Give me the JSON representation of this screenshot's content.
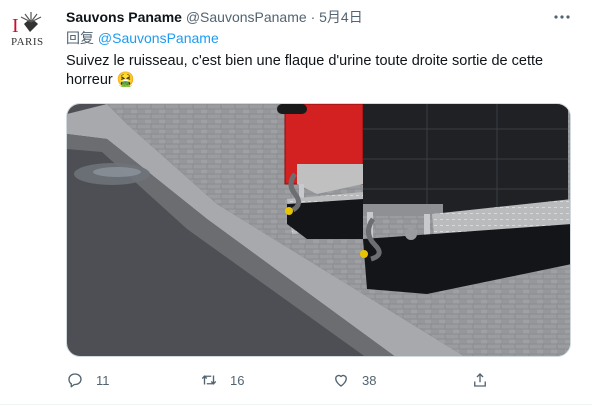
{
  "tweet": {
    "display_name": "Sauvons Paname",
    "handle": "@SauvonsPaname",
    "separator": "·",
    "timestamp": "5月4日",
    "reply_prefix": "回复",
    "reply_to": "@SauvonsPaname",
    "text": "Suivez le ruisseau, c'est bien une flaque d'urine toute droite sortie de cette horreur 🤮",
    "avatar": {
      "letter": "I",
      "caption": "PARIS",
      "accent": "#c8102e"
    },
    "media_alt_icon": "photo-street-toilet"
  },
  "actions": {
    "reply_count": "11",
    "retweet_count": "16",
    "like_count": "38",
    "share_label": ""
  },
  "colors": {
    "link": "#1d9bf0",
    "muted": "#536471",
    "text": "#0f1419"
  }
}
